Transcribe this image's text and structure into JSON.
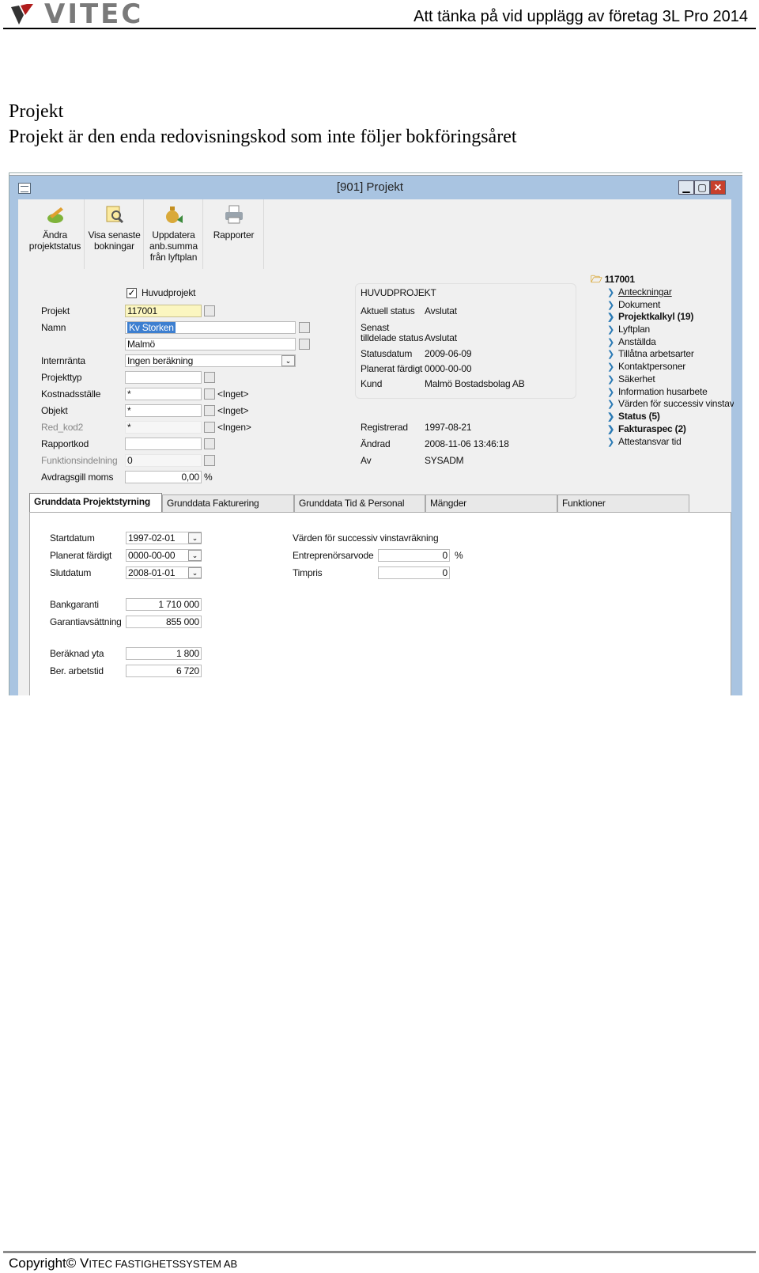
{
  "page": {
    "brand": "VITEC",
    "header_title": "Att tänka på vid upplägg av företag 3L Pro 2014",
    "heading": "Projekt",
    "subheading": "Projekt är den enda redovisningskod som inte följer bokföringsåret",
    "footer_prefix": "Copyright© V",
    "footer_rest": "ITEC FASTIGHETSSYSTEM AB"
  },
  "window": {
    "title": "[901]  Projekt",
    "toolbar": [
      {
        "label": "Ändra projektstatus",
        "icon": "edit-status-icon"
      },
      {
        "label": "Visa senaste bokningar",
        "icon": "view-bookings-icon"
      },
      {
        "label": "Uppdatera anb.summa från lyftplan",
        "icon": "update-sum-icon"
      },
      {
        "label": "Rapporter",
        "icon": "printer-icon"
      }
    ],
    "form": {
      "huvudprojekt_label": "Huvudprojekt",
      "huvudprojekt_checked": true,
      "projekt_label": "Projekt",
      "projekt_value": "117001",
      "namn_label": "Namn",
      "namn_value": "Kv Storken",
      "namn2_value": "Malmö",
      "internranta_label": "Internränta",
      "internranta_value": "Ingen beräkning",
      "projekttyp_label": "Projekttyp",
      "projekttyp_value": "",
      "kostnadsstalle_label": "Kostnadsställe",
      "kostnadsstalle_value": "*",
      "kostnadsstalle_desc": "<Inget>",
      "objekt_label": "Objekt",
      "objekt_value": "*",
      "objekt_desc": "<Inget>",
      "redkod2_label": "Red_kod2",
      "redkod2_value": "*",
      "redkod2_desc": "<Ingen>",
      "rapportkod_label": "Rapportkod",
      "rapportkod_value": "",
      "funktion_label": "Funktionsindelning",
      "funktion_value": "0",
      "avdrag_label": "Avdragsgill moms",
      "avdrag_value": "0,00",
      "avdrag_unit": "%"
    },
    "huvudprojekt": {
      "title": "HUVUDPROJEKT",
      "aktuell_label": "Aktuell status",
      "aktuell_value": "Avslutat",
      "senast_label1": "Senast",
      "senast_label2": "tilldelade status",
      "senast_value": "Avslutat",
      "statusdatum_label": "Statusdatum",
      "statusdatum_value": "2009-06-09",
      "planerat_label": "Planerat färdigt",
      "planerat_value": "0000-00-00",
      "kund_label": "Kund",
      "kund_value": "Malmö Bostadsbolag AB",
      "registrerad_label": "Registrerad",
      "registrerad_value": "1997-08-21",
      "andrad_label": "Ändrad",
      "andrad_value": "2008-11-06 13:46:18",
      "av_label": "Av",
      "av_value": "SYSADM"
    },
    "tree": {
      "root": "117001",
      "items": [
        {
          "label": "Anteckningar",
          "style": "u"
        },
        {
          "label": "Dokument",
          "style": ""
        },
        {
          "label": "Projektkalkyl (19)",
          "style": "b"
        },
        {
          "label": "Lyftplan",
          "style": ""
        },
        {
          "label": "Anställda",
          "style": ""
        },
        {
          "label": "Tillåtna arbetsarter",
          "style": ""
        },
        {
          "label": "Kontaktpersoner",
          "style": ""
        },
        {
          "label": "Säkerhet",
          "style": ""
        },
        {
          "label": "Information husarbete",
          "style": ""
        },
        {
          "label": "Värden för successiv vinstavrä",
          "style": ""
        },
        {
          "label": "Status (5)",
          "style": "b"
        },
        {
          "label": "Fakturaspec (2)",
          "style": "b"
        },
        {
          "label": "Attestansvar tid",
          "style": ""
        }
      ]
    },
    "tabs": [
      "Grunddata Projektstyrning",
      "Grunddata Fakturering",
      "Grunddata Tid & Personal",
      "Mängder",
      "Funktioner"
    ],
    "panel": {
      "startdatum_label": "Startdatum",
      "startdatum_value": "1997-02-01",
      "planerat_label": "Planerat färdigt",
      "planerat_value": "0000-00-00",
      "slutdatum_label": "Slutdatum",
      "slutdatum_value": "2008-01-01",
      "bankgaranti_label": "Bankgaranti",
      "bankgaranti_value": "1 710 000",
      "garanti_label": "Garantiavsättning",
      "garanti_value": "855 000",
      "yta_label": "Beräknad yta",
      "yta_value": "1 800",
      "arbetstid_label": "Ber. arbetstid",
      "arbetstid_value": "6 720",
      "varden_title": "Värden för successiv vinstavräkning",
      "entre_label": "Entreprenörsarvode",
      "entre_value": "0",
      "entre_unit": "%",
      "timpris_label": "Timpris",
      "timpris_value": "0"
    }
  }
}
